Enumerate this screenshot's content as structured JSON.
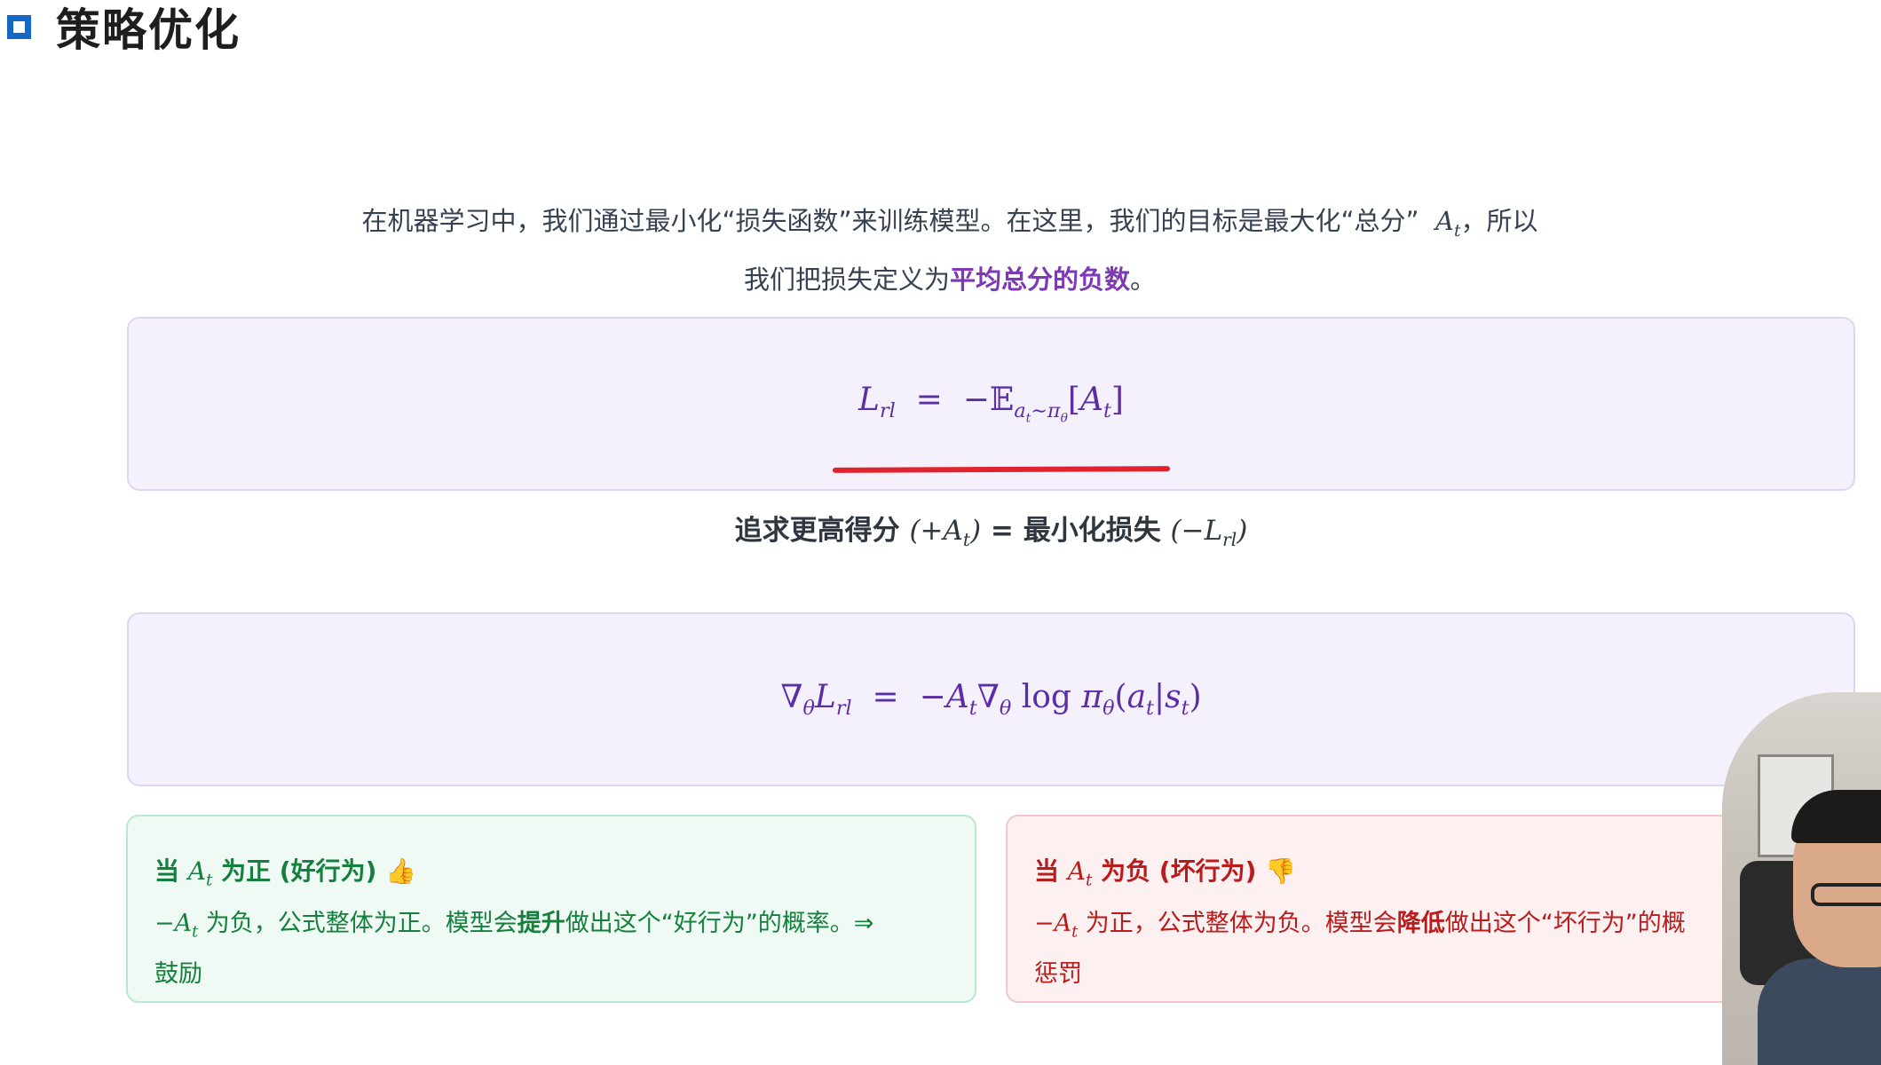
{
  "page": {
    "title": "策略优化"
  },
  "intro": {
    "line1_before": "在机器学习中，我们通过最小化“损失函数”来训练模型。在这里，我们的目标是最大化“总分”",
    "line1_after": "，所以",
    "line2_before": "我们把损失定义为",
    "line2_highlight": "平均总分的负数",
    "line2_after": "。"
  },
  "caption": {
    "part1": "追求更高得分",
    "eq": "=",
    "part2": "最小化损失"
  },
  "cards": {
    "good": {
      "title_prefix": "当",
      "title_suffix": "为正 (好行为)",
      "emoji": "👍",
      "body_before": "为负，公式整体为正。模型会",
      "body_bold": "提升",
      "body_after": "做出这个“好行为”的概率。⇒",
      "body_line2": "鼓励"
    },
    "bad": {
      "title_prefix": "当",
      "title_suffix": "为负 (坏行为)",
      "emoji": "👎",
      "body_before": "为正，公式整体为负。模型会",
      "body_bold": "降低",
      "body_after": "做出这个“坏行为”的概",
      "body_line2": "惩罚"
    }
  },
  "colors": {
    "accent_blue": "#1467c4",
    "highlight_purple": "#7e3ab5",
    "formula_purple": "#5b2ea6",
    "good_green": "#15803d",
    "bad_red": "#b91c1c",
    "annotation_red": "#e0242e"
  }
}
